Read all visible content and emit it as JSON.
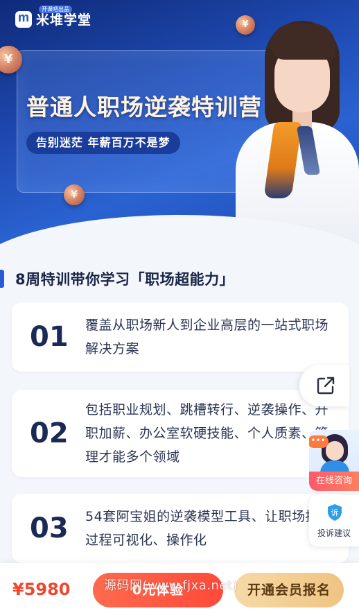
{
  "brand": {
    "logo_text": "米堆学堂",
    "logo_tag": "开课吧出品"
  },
  "hero": {
    "title": "普通人职场逆袭特训营",
    "subtitle": "告别迷茫  年薪百万不是梦",
    "coin_symbol": "¥"
  },
  "section": {
    "title": "8周特训带你学习「职场超能力」"
  },
  "cards": [
    {
      "number": "01",
      "text": "覆盖从职场新人到企业高层的一站式职场解决方案"
    },
    {
      "number": "02",
      "text": "包括职业规划、跳槽转行、逆袭操作、升职加薪、办公室软硬技能、个人质素、管理才能多个领域"
    },
    {
      "number": "03",
      "text": "54套阿宝姐的逆袭模型工具、让职场提升过程可视化、操作化"
    }
  ],
  "widgets": {
    "share_icon": "external-link-icon",
    "consult_label": "在线咨询",
    "consult_bubble": "•••",
    "complaint_label": "投诉建议",
    "complaint_badge": "诉"
  },
  "bottom_bar": {
    "price": "¥5980",
    "trial_button": "0元体验",
    "member_button": "开通会员报名",
    "watermark": "源码网(www.fjxa.net)"
  },
  "colors": {
    "hero_blue": "#1f4bb3",
    "accent_blue": "#2a5bd7",
    "price_red": "#f0462e",
    "trial_red": "#ff4a3a",
    "member_gold": "#efc482"
  }
}
